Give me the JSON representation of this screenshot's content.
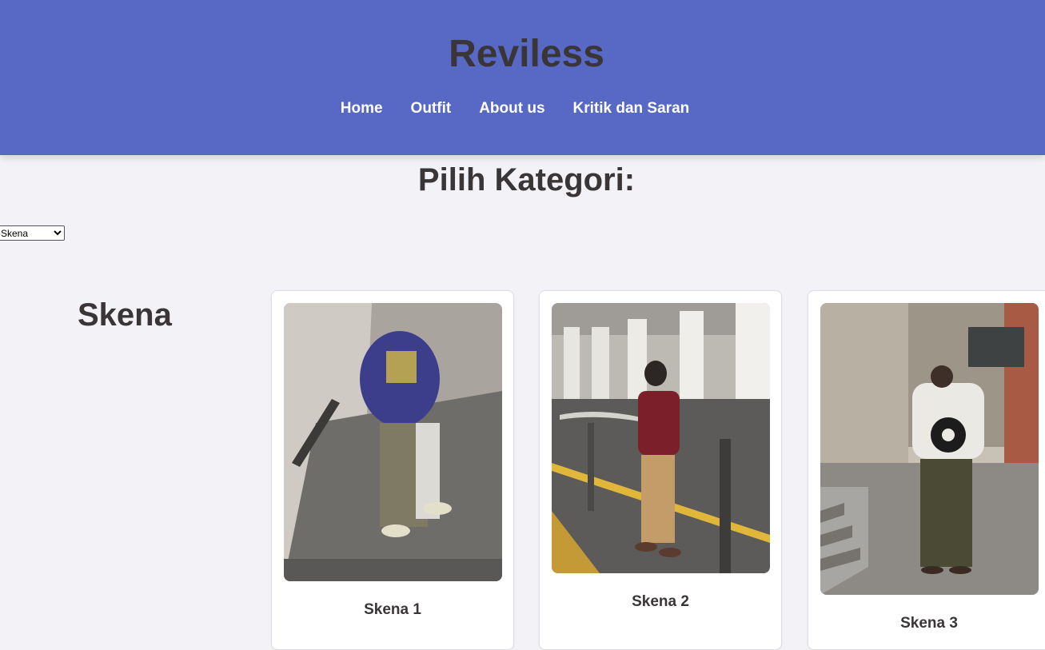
{
  "header": {
    "title": "Reviless",
    "nav": [
      "Home",
      "Outfit",
      "About us",
      "Kritik dan Saran"
    ]
  },
  "section_title": "Pilih Kategori:",
  "category_select": {
    "selected": "Skena",
    "options": [
      "Skena"
    ]
  },
  "category_heading": "Skena",
  "products": [
    {
      "label": "Skena 1",
      "image": "photo-outfit-sweatshirt-cargo"
    },
    {
      "label": "Skena 2",
      "image": "photo-outfit-varsity-jacket"
    },
    {
      "label": "Skena 3",
      "image": "photo-outfit-graphic-sweater"
    }
  ],
  "colors": {
    "header_bg": "#5769c4",
    "page_bg": "#f3f2f7",
    "text_dark": "#3a3637",
    "nav_text": "#ffffff"
  }
}
